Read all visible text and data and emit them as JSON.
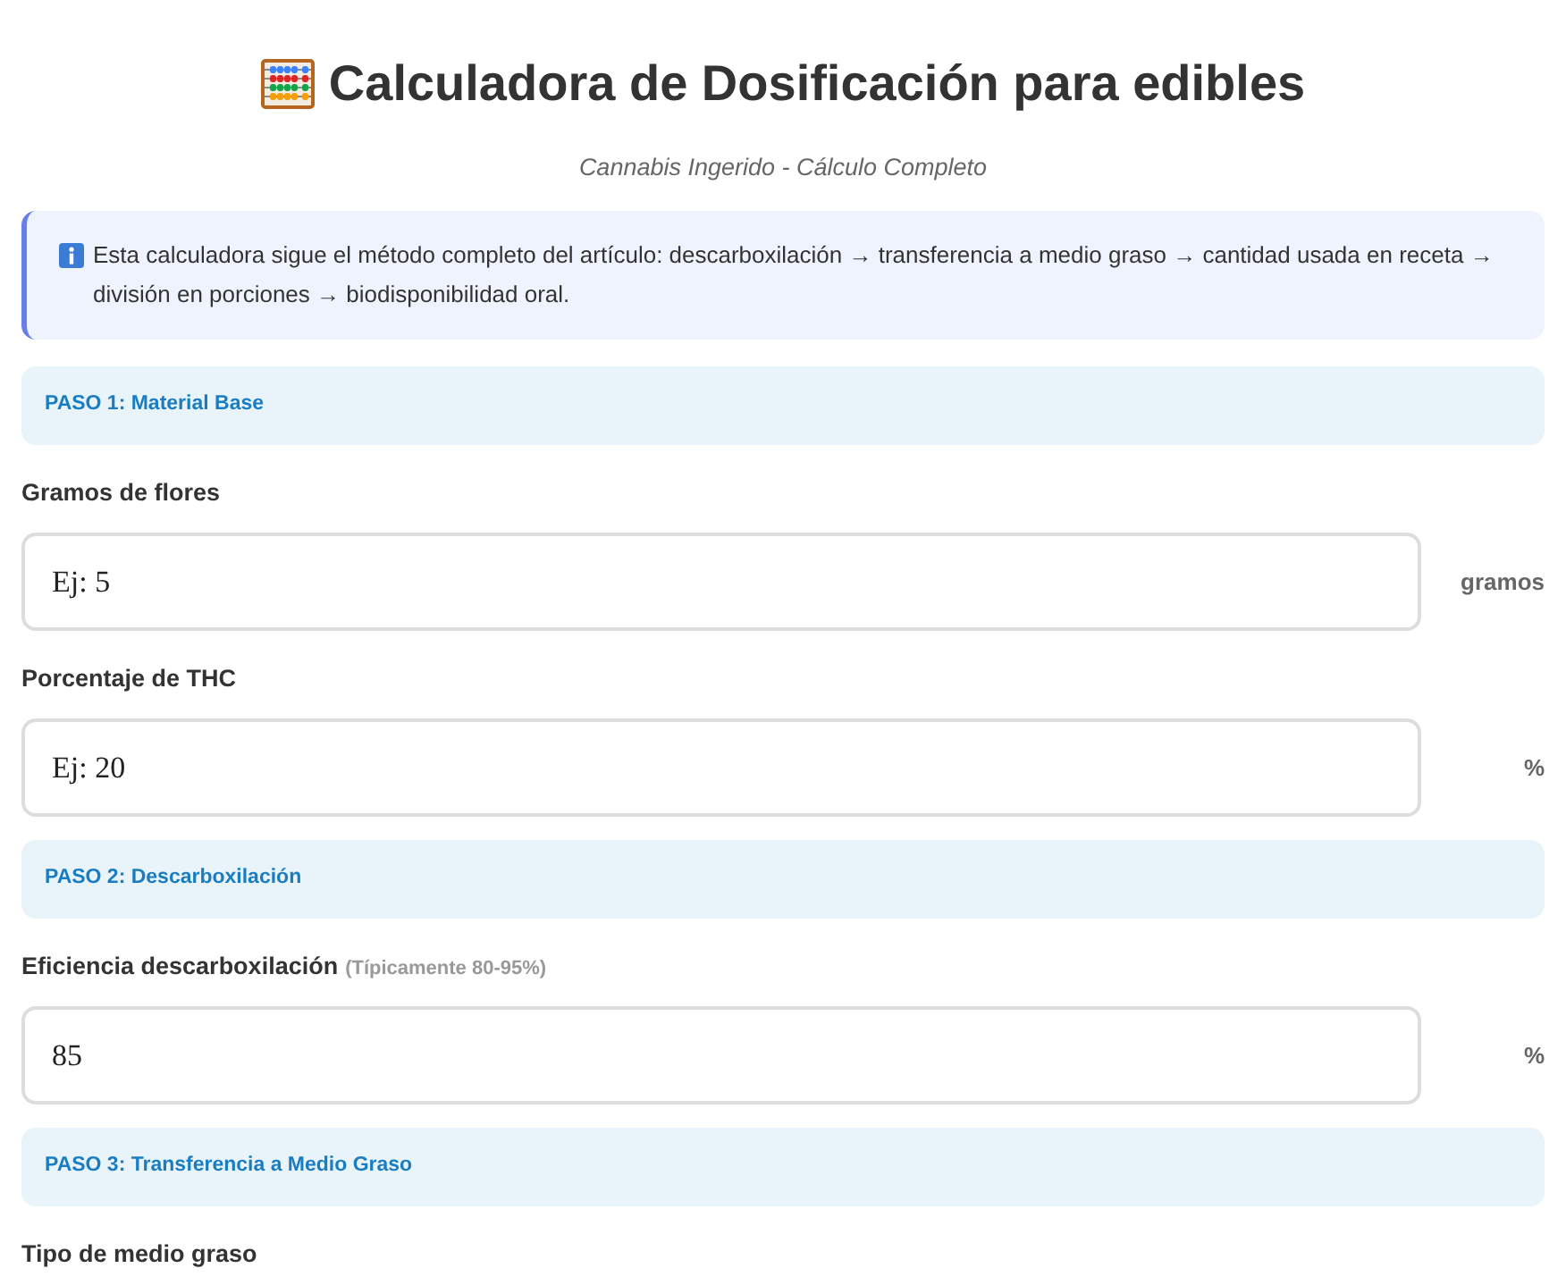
{
  "header": {
    "title": "Calculadora de Dosificación para edibles",
    "subtitle": "Cannabis Ingerido - Cálculo Completo"
  },
  "info": {
    "text": "Esta calculadora sigue el método completo del artículo: descarboxilación → transferencia a medio graso → cantidad usada en receta → división en porciones → biodisponibilidad oral."
  },
  "sections": [
    {
      "heading": "PASO 1: Material Base",
      "fields": [
        {
          "label": "Gramos de flores",
          "placeholder": "Ej: 5",
          "unit": "gramos"
        },
        {
          "label": "Porcentaje de THC",
          "placeholder": "Ej: 20",
          "unit": "%"
        }
      ]
    },
    {
      "heading": "PASO 2: Descarboxilación",
      "fields": [
        {
          "label": "Eficiencia descarboxilación",
          "hint": "(Típicamente 80-95%)",
          "value": "85",
          "unit": "%"
        }
      ]
    },
    {
      "heading": "PASO 3: Transferencia a Medio Graso",
      "fields": [
        {
          "label": "Tipo de medio graso"
        }
      ]
    }
  ]
}
